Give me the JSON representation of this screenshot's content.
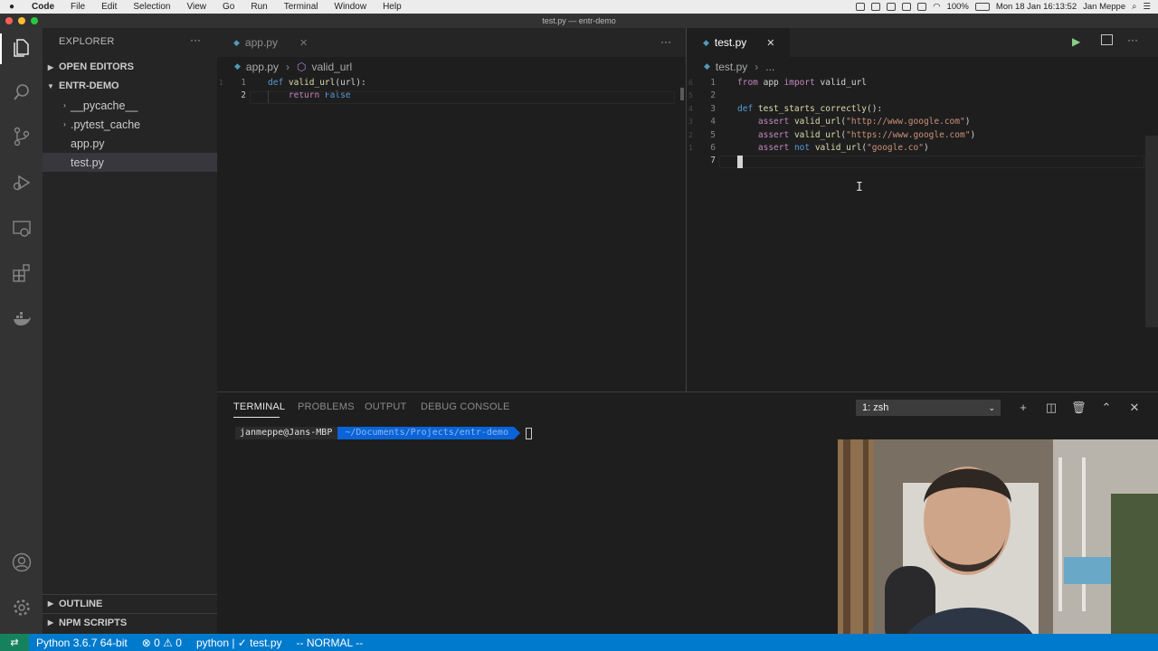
{
  "menubar": {
    "app": "Code",
    "items": [
      "File",
      "Edit",
      "Selection",
      "View",
      "Go",
      "Run",
      "Terminal",
      "Window",
      "Help"
    ],
    "battery": "100%",
    "datetime": "Mon 18 Jan 16:13:52",
    "user": "Jan Meppe"
  },
  "window": {
    "title": "test.py — entr-demo"
  },
  "sidebar": {
    "title": "EXPLORER",
    "open_editors": "OPEN EDITORS",
    "project": "ENTR-DEMO",
    "items": [
      {
        "label": "__pycache__",
        "type": "folder"
      },
      {
        "label": ".pytest_cache",
        "type": "folder"
      },
      {
        "label": "app.py",
        "type": "file"
      },
      {
        "label": "test.py",
        "type": "file"
      }
    ],
    "outline": "OUTLINE",
    "npm": "NPM SCRIPTS"
  },
  "left_editor": {
    "tab": "app.py",
    "breadcrumb_file": "app.py",
    "breadcrumb_symbol": "valid_url",
    "line_numbers": [
      "1",
      "2"
    ],
    "rel_numbers": [
      "1"
    ],
    "lines": [
      [
        {
          "t": "def ",
          "c": "kwb"
        },
        {
          "t": "valid_url",
          "c": "fn"
        },
        {
          "t": "(url):",
          "c": "txt"
        }
      ],
      [
        {
          "t": "    ",
          "c": "txt"
        },
        {
          "t": "return ",
          "c": "kw"
        },
        {
          "t": "False",
          "c": "kwb"
        }
      ]
    ]
  },
  "right_editor": {
    "tab": "test.py",
    "breadcrumb_file": "test.py",
    "breadcrumb_more": "...",
    "line_numbers": [
      "1",
      "2",
      "3",
      "4",
      "5",
      "6",
      "7"
    ],
    "rel_numbers": [
      "6",
      "5",
      "4",
      "3",
      "2",
      "1"
    ],
    "lines": [
      [
        {
          "t": "from ",
          "c": "kw"
        },
        {
          "t": "app ",
          "c": "txt"
        },
        {
          "t": "import ",
          "c": "kw"
        },
        {
          "t": "valid_url",
          "c": "txt"
        }
      ],
      [],
      [
        {
          "t": "def ",
          "c": "kwb"
        },
        {
          "t": "test_starts_correctly",
          "c": "fn"
        },
        {
          "t": "():",
          "c": "txt"
        }
      ],
      [
        {
          "t": "    ",
          "c": "txt"
        },
        {
          "t": "assert ",
          "c": "kw"
        },
        {
          "t": "valid_url",
          "c": "fn"
        },
        {
          "t": "(",
          "c": "txt"
        },
        {
          "t": "\"http://www.google.com\"",
          "c": "str"
        },
        {
          "t": ")",
          "c": "txt"
        }
      ],
      [
        {
          "t": "    ",
          "c": "txt"
        },
        {
          "t": "assert ",
          "c": "kw"
        },
        {
          "t": "valid_url",
          "c": "fn"
        },
        {
          "t": "(",
          "c": "txt"
        },
        {
          "t": "\"https://www.google.com\"",
          "c": "str"
        },
        {
          "t": ")",
          "c": "txt"
        }
      ],
      [
        {
          "t": "    ",
          "c": "txt"
        },
        {
          "t": "assert ",
          "c": "kw"
        },
        {
          "t": "not ",
          "c": "kwb"
        },
        {
          "t": "valid_url",
          "c": "fn"
        },
        {
          "t": "(",
          "c": "txt"
        },
        {
          "t": "\"google.co\"",
          "c": "str"
        },
        {
          "t": ")",
          "c": "txt"
        }
      ],
      []
    ]
  },
  "panel": {
    "tabs": [
      "TERMINAL",
      "PROBLEMS",
      "OUTPUT",
      "DEBUG CONSOLE"
    ],
    "terminal_select": "1: zsh",
    "prompt_user": "janmeppe@Jans-MBP",
    "prompt_path": "~/Documents/Projects/entr-demo"
  },
  "statusbar": {
    "interpreter": "Python 3.6.7 64-bit",
    "errors": "0",
    "warnings": "0",
    "branch": "python | ✓ test.py",
    "mode": "-- NORMAL --"
  },
  "colors": {
    "accent": "#007acc",
    "remote": "#16825d",
    "python_icon": "#519aba",
    "prompt_path_bg": "#0a64d8"
  }
}
